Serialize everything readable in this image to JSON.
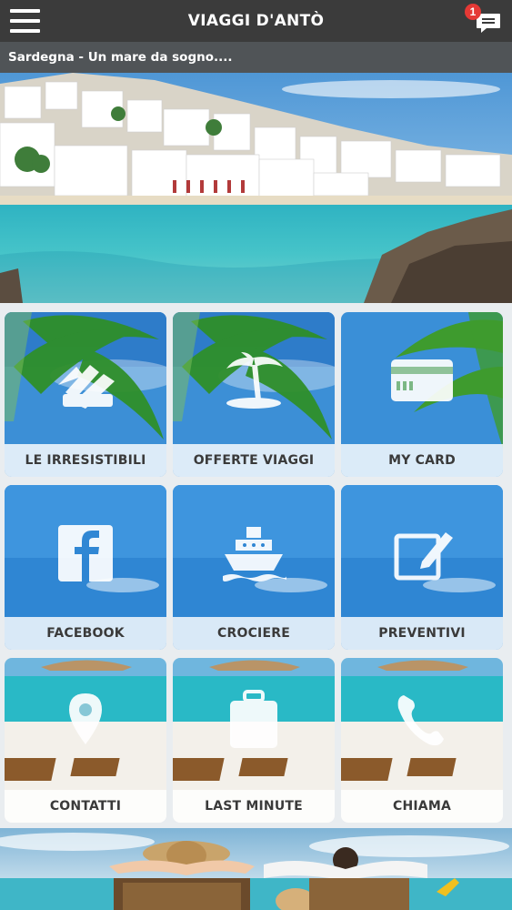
{
  "header": {
    "title": "VIAGGI D'ANTÒ",
    "menu_icon": "hamburger-menu-icon",
    "chat_icon": "chat-bubble-icon",
    "notification_count": "1"
  },
  "ticker": {
    "text": "Sardegna - Un mare da sogno...."
  },
  "tiles": [
    {
      "label": "LE IRRESISTIBILI",
      "icon": "ticket-fan-icon"
    },
    {
      "label": "OFFERTE VIAGGI",
      "icon": "palm-island-icon"
    },
    {
      "label": "MY CARD",
      "icon": "credit-card-icon"
    },
    {
      "label": "FACEBOOK",
      "icon": "facebook-icon"
    },
    {
      "label": "CROCIERE",
      "icon": "ship-icon"
    },
    {
      "label": "PREVENTIVI",
      "icon": "edit-note-icon"
    },
    {
      "label": "CONTATTI",
      "icon": "map-pin-icon"
    },
    {
      "label": "LAST MINUTE",
      "icon": "suitcase-icon"
    },
    {
      "label": "CHIAMA",
      "icon": "phone-icon"
    }
  ],
  "colors": {
    "topbar": "#3b3b3b",
    "ticker": "#505457",
    "label_text": "#3a3a3a",
    "badge": "#e53935"
  }
}
